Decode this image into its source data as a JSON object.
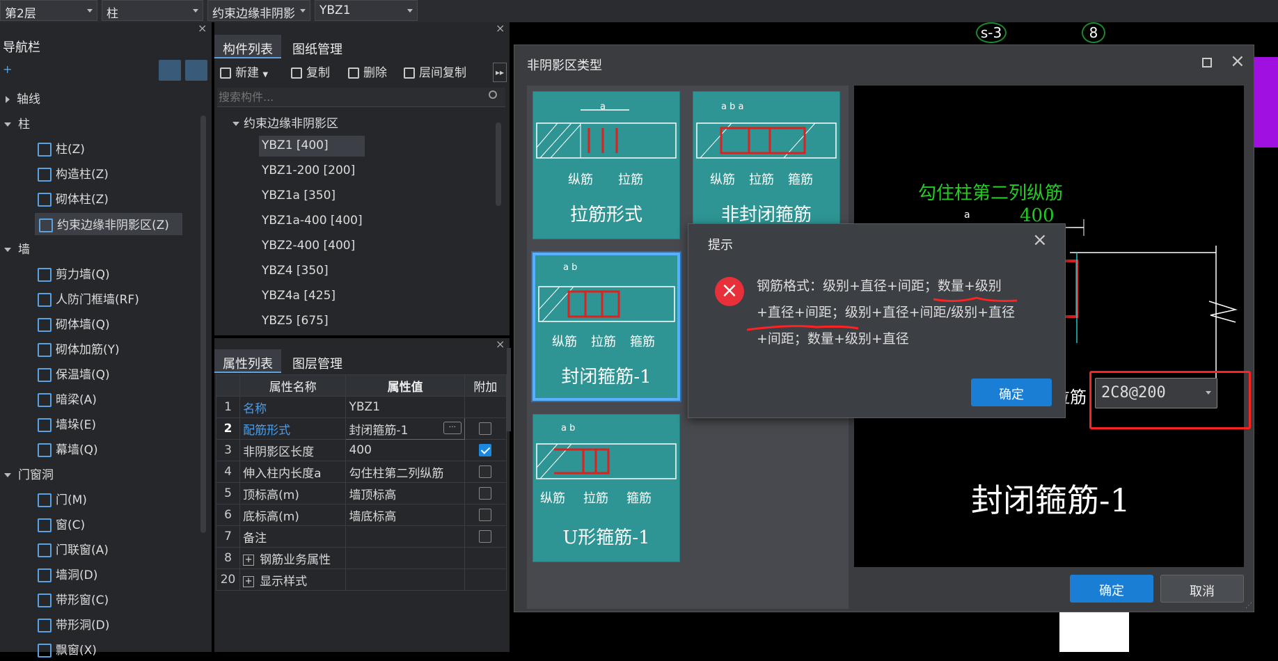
{
  "topbar": {
    "floor": "第2层",
    "category": "柱",
    "subtype": "约束边缘非阴影",
    "component": "YBZ1"
  },
  "nav": {
    "title": "导航栏",
    "groups": [
      {
        "label": "轴线"
      },
      {
        "label": "柱"
      },
      {
        "label": "墙"
      },
      {
        "label": "门窗洞"
      }
    ],
    "items": [
      {
        "label": "柱(Z)"
      },
      {
        "label": "构造柱(Z)"
      },
      {
        "label": "砌体柱(Z)"
      },
      {
        "label": "约束边缘非阴影区(Z)"
      },
      {
        "label": "剪力墙(Q)"
      },
      {
        "label": "人防门框墙(RF)"
      },
      {
        "label": "砌体墙(Q)"
      },
      {
        "label": "砌体加筋(Y)"
      },
      {
        "label": "保温墙(Q)"
      },
      {
        "label": "暗梁(A)"
      },
      {
        "label": "墙垛(E)"
      },
      {
        "label": "幕墙(Q)"
      },
      {
        "label": "门(M)"
      },
      {
        "label": "窗(C)"
      },
      {
        "label": "门联窗(A)"
      },
      {
        "label": "墙洞(D)"
      },
      {
        "label": "带形窗(C)"
      },
      {
        "label": "带形洞(D)"
      },
      {
        "label": "飘窗(X)"
      }
    ]
  },
  "complist": {
    "tabs": [
      "构件列表",
      "图纸管理"
    ],
    "tools": {
      "new": "新建",
      "copy": "复制",
      "delete": "删除",
      "floorcopy": "层间复制"
    },
    "search_placeholder": "搜索构件...",
    "group": "约束边缘非阴影区",
    "items": [
      "YBZ1 [400]",
      "YBZ1-200 [200]",
      "YBZ1a [350]",
      "YBZ1a-400 [400]",
      "YBZ2-400 [400]",
      "YBZ4 [350]",
      "YBZ4a [425]",
      "YBZ5 [675]"
    ]
  },
  "props": {
    "tabs": [
      "属性列表",
      "图层管理"
    ],
    "headers": {
      "name": "属性名称",
      "value": "属性值",
      "extra": "附加"
    },
    "rows": [
      {
        "n": "1",
        "name": "名称",
        "value": "YBZ1"
      },
      {
        "n": "2",
        "name": "配筋形式",
        "value": "封闭箍筋-1"
      },
      {
        "n": "3",
        "name": "非阴影区长度",
        "value": "400"
      },
      {
        "n": "4",
        "name": "伸入柱内长度a",
        "value": "勾住柱第二列纵筋"
      },
      {
        "n": "5",
        "name": "顶标高(m)",
        "value": "墙顶标高"
      },
      {
        "n": "6",
        "name": "底标高(m)",
        "value": "墙底标高"
      },
      {
        "n": "7",
        "name": "备注",
        "value": ""
      },
      {
        "n": "8",
        "name": "钢筋业务属性",
        "value": ""
      },
      {
        "n": "20",
        "name": "显示样式",
        "value": ""
      }
    ]
  },
  "canvas": {
    "label1": "s-3",
    "label2": "8"
  },
  "dialog": {
    "title": "非阴影区类型",
    "cards": [
      {
        "label": "拉筋形式",
        "dims": "a",
        "tags": [
          "纵筋",
          "拉筋"
        ]
      },
      {
        "label": "非封闭箍筋",
        "dims": "a b a",
        "tags": [
          "纵筋",
          "拉筋",
          "箍筋"
        ]
      },
      {
        "label": "封闭箍筋-1",
        "dims": "a b",
        "tags": [
          "纵筋",
          "拉筋",
          "箍筋"
        ]
      },
      {
        "label": "U形箍筋-1",
        "dims": "a b",
        "tags": [
          "纵筋",
          "拉筋",
          "箍筋"
        ]
      }
    ],
    "preview": {
      "note": "勾住柱第二列纵筋",
      "dim": "400",
      "dim_a": "a",
      "tie_label": "拉筋",
      "input_value": "2C8@200",
      "big_label": "封闭箍筋-1"
    },
    "ok": "确定",
    "cancel": "取消"
  },
  "message": {
    "title": "提示",
    "line1": "钢筋格式：级别+直径+间距；数量+级别",
    "line2": "+直径+间距；级别+直径+间距/级别+直径",
    "line3": "+间距；数量+级别+直径",
    "ok": "确定"
  },
  "colors": {
    "accent": "#1a7fd4",
    "card": "#2e9594",
    "rebar": "#e0201f",
    "note_green": "#22cc22",
    "annotation": "#ff2222"
  }
}
